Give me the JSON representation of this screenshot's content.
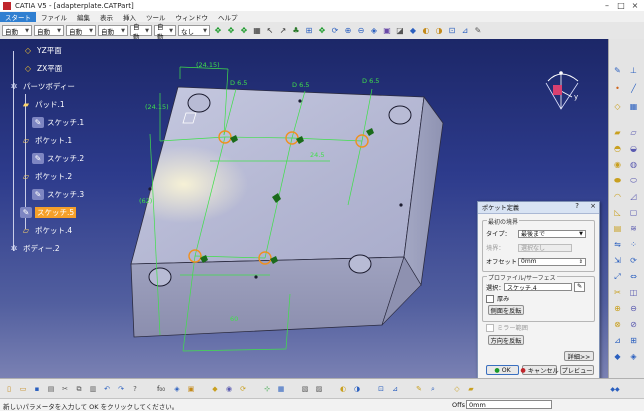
{
  "window": {
    "title": "CATIA V5 - [adapterplate.CATPart]",
    "minimize": "–",
    "maximize": "□",
    "close": "×"
  },
  "menu": {
    "items": [
      "スタート",
      "ファイル",
      "編集",
      "表示",
      "挿入",
      "ツール",
      "ウィンドウ",
      "ヘルプ"
    ]
  },
  "toolbar": {
    "dropdowns": [
      "自動",
      "自動",
      "自動",
      "自動",
      "自動",
      "自動",
      "なし"
    ]
  },
  "tree": {
    "nodes": [
      {
        "label": "YZ平面",
        "icon": "plane-icon"
      },
      {
        "label": "ZX平面",
        "icon": "plane-icon"
      },
      {
        "label": "パーツボディー",
        "icon": "gear-icon"
      },
      {
        "label": "パッド.1",
        "icon": "pad-icon"
      },
      {
        "label": "スケッチ.1",
        "icon": "sketch-icon"
      },
      {
        "label": "ポケット.1",
        "icon": "pocket-icon"
      },
      {
        "label": "スケッチ.2",
        "icon": "sketch-icon"
      },
      {
        "label": "ポケット.2",
        "icon": "pocket-icon"
      },
      {
        "label": "スケッチ.3",
        "icon": "sketch-icon"
      },
      {
        "label": "スケッチ.5",
        "icon": "sketch-icon"
      },
      {
        "label": "ポケット.4",
        "icon": "pocket-icon"
      },
      {
        "label": "ボディー.2",
        "icon": "body-icon"
      }
    ]
  },
  "model": {
    "dimensions": [
      "D 6.5",
      "D 6.5",
      "D 6.5",
      "(24.15)",
      "(24.15)",
      "(62)",
      "60",
      "24.5"
    ],
    "axis_label": "y"
  },
  "dialog": {
    "title": "ポケット定義",
    "help": "?",
    "close": "×",
    "first_limit_group": "最初の境界",
    "type_label": "タイプ：",
    "type_value": "最後まで",
    "limit_label": "境界：",
    "limit_value": "選択なし",
    "offset_label": "オフセット：",
    "offset_value": "0mm",
    "profile_group": "プロファイル/サーフェス",
    "selection_label": "選択：",
    "selection_value": "スケッチ.4",
    "thick_label": "厚み",
    "reverse_side_button": "側面を反転",
    "mirror_label": "ミラー範囲",
    "reverse_direction_button": "方向を反転",
    "more_button": "詳細>>",
    "ok_button": "OK",
    "cancel_button": "キャンセル",
    "preview_button": "プレビュー"
  },
  "status": {
    "message": "新しいパラメータを入力して OK をクリックしてください。",
    "offset_label": "Offs",
    "offset_value": "0mm"
  },
  "colors": {
    "viewport_top": "#1c2768",
    "viewport_bottom": "#7a81b3",
    "dimension_green": "#3fe04a",
    "hole_orange": "#f0901e",
    "selected_node": "#f6a02a",
    "part_face": "#b9bcd6"
  }
}
